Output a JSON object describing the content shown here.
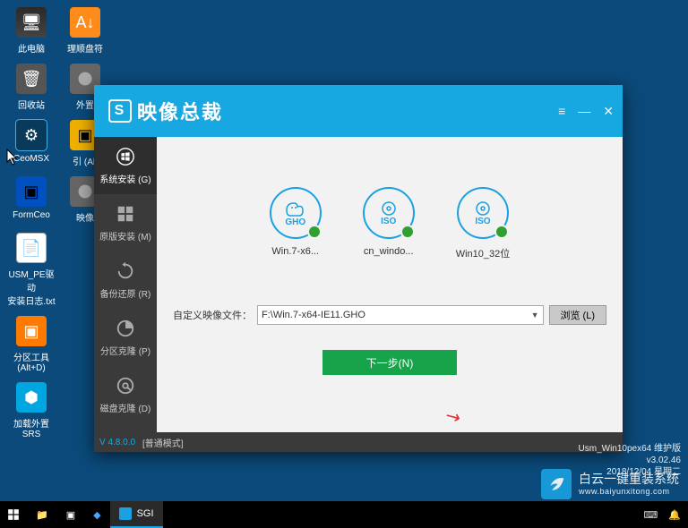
{
  "desktop": {
    "row1": [
      {
        "label": "此电脑",
        "glyph": "pc"
      },
      {
        "label": "理顺盘符",
        "glyph": "az"
      }
    ],
    "row2": [
      {
        "label": "回收站",
        "glyph": "trash"
      },
      {
        "label": "外置",
        "glyph": "cd"
      }
    ],
    "row3": [
      {
        "label": "CeoMSX",
        "glyph": "gear",
        "selected": true
      },
      {
        "label": "引\n(Alt",
        "glyph": "square"
      }
    ],
    "row4": [
      {
        "label": "FormCeo",
        "glyph": "square"
      },
      {
        "label": "映像",
        "glyph": "cd"
      }
    ],
    "row5": [
      {
        "label": "USM_PE驱动\n安装日志.txt",
        "glyph": "file"
      }
    ],
    "row6": [
      {
        "label": "分区工具\n(Alt+D)",
        "glyph": "orange"
      }
    ],
    "row7": [
      {
        "label": "加载外置SRS",
        "glyph": "blue"
      }
    ]
  },
  "app": {
    "title": "映像总裁",
    "sidebar": [
      {
        "label": "系统安装 (G)",
        "key": "system-install",
        "active": true
      },
      {
        "label": "原版安装 (M)",
        "key": "original-install"
      },
      {
        "label": "备份还原 (R)",
        "key": "backup-restore"
      },
      {
        "label": "分区克隆 (P)",
        "key": "partition-clone"
      },
      {
        "label": "磁盘克隆 (D)",
        "key": "disk-clone"
      }
    ],
    "images": [
      {
        "label": "Win.7-x6...",
        "tag": "GHO"
      },
      {
        "label": "cn_windo...",
        "tag": "ISO"
      },
      {
        "label": "Win10_32位",
        "tag": "ISO"
      }
    ],
    "path_label": "自定义映像文件：",
    "path_value": "F:\\Win.7-x64-IE11.GHO",
    "browse_label": "浏览 (L)",
    "next_label": "下一步(N)",
    "version": "V 4.8.0.0",
    "mode": "[普通模式]"
  },
  "taskbar": {
    "app_btn": "SGI"
  },
  "sysinfo": {
    "line1": "Usm_Win10pex64 维护版",
    "line2": "v3.02.46",
    "line3": "2018/12/04 星期二"
  },
  "watermark": {
    "brand": "白云一键重装系统",
    "url": "www.baiyunxitong.com"
  }
}
